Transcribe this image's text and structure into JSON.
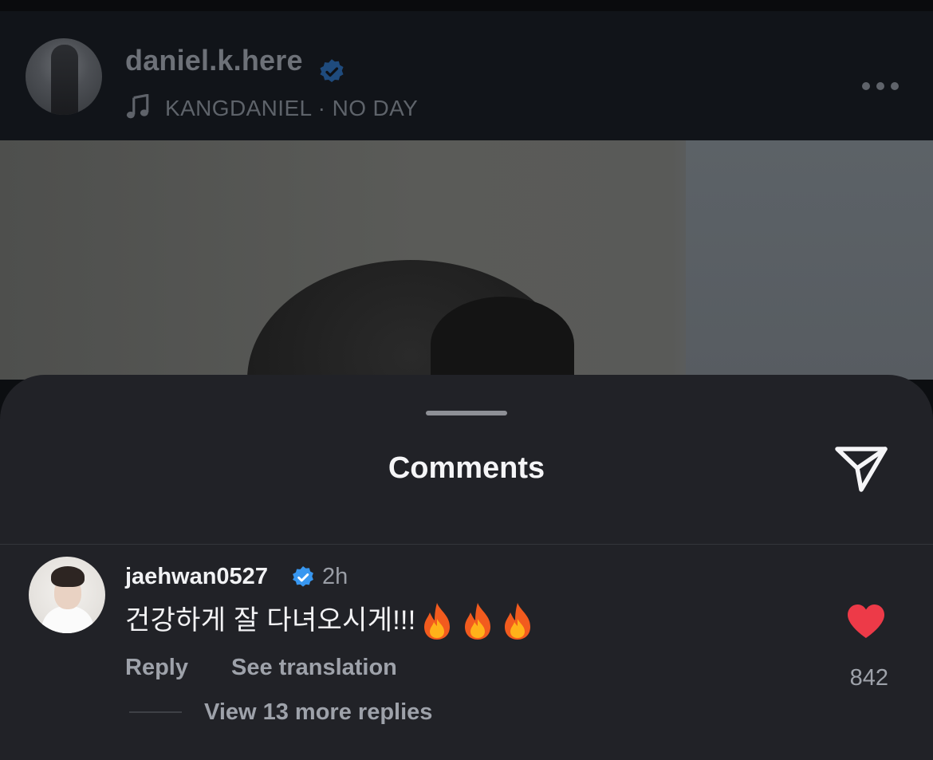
{
  "post": {
    "username": "daniel.k.here",
    "verified": true,
    "music": {
      "artist": "KANGDANIEL",
      "separator": "·",
      "track": "NO DAY",
      "icon": "music-note-icon"
    },
    "more_icon": "more-dots-icon"
  },
  "comments_sheet": {
    "title": "Comments",
    "share_icon": "send-icon",
    "comments": [
      {
        "username": "jaehwan0527",
        "verified": true,
        "time": "2h",
        "text": "건강하게 잘 다녀오시게!!!",
        "emoji": [
          "🔥",
          "🔥",
          "🔥"
        ],
        "reply_label": "Reply",
        "translate_label": "See translation",
        "like_count": "842",
        "liked": true,
        "like_color": "#ed3a48",
        "view_replies_label": "View 13 more replies"
      }
    ]
  },
  "colors": {
    "verified_blue": "#3897f0",
    "sheet_background": "#212227",
    "header_background": "#111419"
  }
}
